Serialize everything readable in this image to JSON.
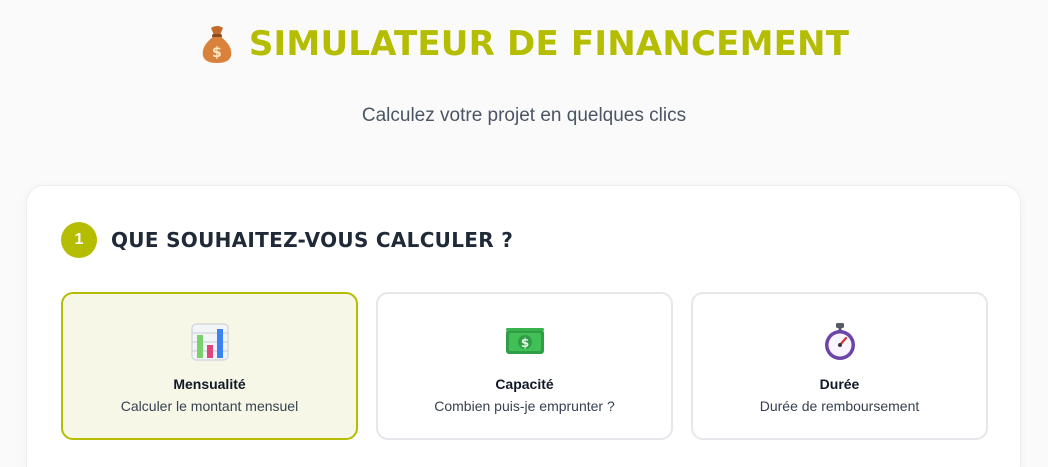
{
  "header": {
    "title": "SIMULATEUR DE FINANCEMENT",
    "title_icon": "money-bag-icon",
    "subtitle": "Calculez votre projet en quelques clics"
  },
  "step": {
    "number": "1",
    "title": "QUE SOUHAITEZ-VOUS CALCULER ?"
  },
  "options": [
    {
      "label": "Mensualité",
      "description": "Calculer le montant mensuel",
      "icon": "bar-chart-icon",
      "selected": true
    },
    {
      "label": "Capacité",
      "description": "Combien puis-je emprunter ?",
      "icon": "money-bill-icon",
      "selected": false
    },
    {
      "label": "Durée",
      "description": "Durée de remboursement",
      "icon": "stopwatch-icon",
      "selected": false
    }
  ],
  "colors": {
    "accent": "#b5bd00",
    "selected_bg": "#f6f7e6",
    "border": "#e5e7eb"
  }
}
